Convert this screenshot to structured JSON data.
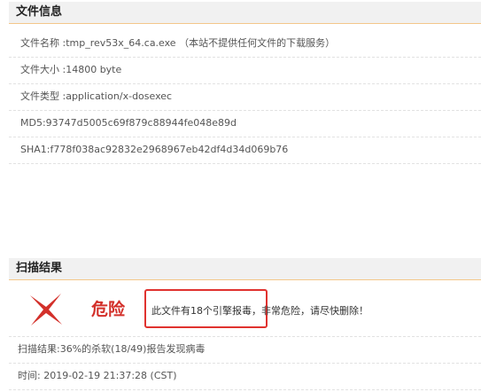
{
  "file_info": {
    "heading": "文件信息",
    "rows": [
      "文件名称 :tmp_rev53x_64.ca.exe （本站不提供任何文件的下载服务）",
      "文件大小 :14800 byte",
      "文件类型 :application/x-dosexec",
      "MD5:93747d5005c69f879c88944fe048e89d",
      "SHA1:f778f038ac92832e2968967eb42df4d34d069b76"
    ]
  },
  "scan_result": {
    "heading": "扫描结果",
    "verdict_label": "危险",
    "verdict_message": "此文件有18个引擎报毒，非常危险，请尽快删除！",
    "rows": [
      "扫描结果:36%的杀软(18/49)报告发现病毒",
      "时间: 2019-02-19 21:37:28 (CST)"
    ]
  },
  "colors": {
    "danger": "#d3302a",
    "highlight_border": "#e0322f",
    "header_bg": "#f1f1f1",
    "header_border": "#f4c78a"
  },
  "icons": {
    "verdict": "red-x-icon"
  }
}
